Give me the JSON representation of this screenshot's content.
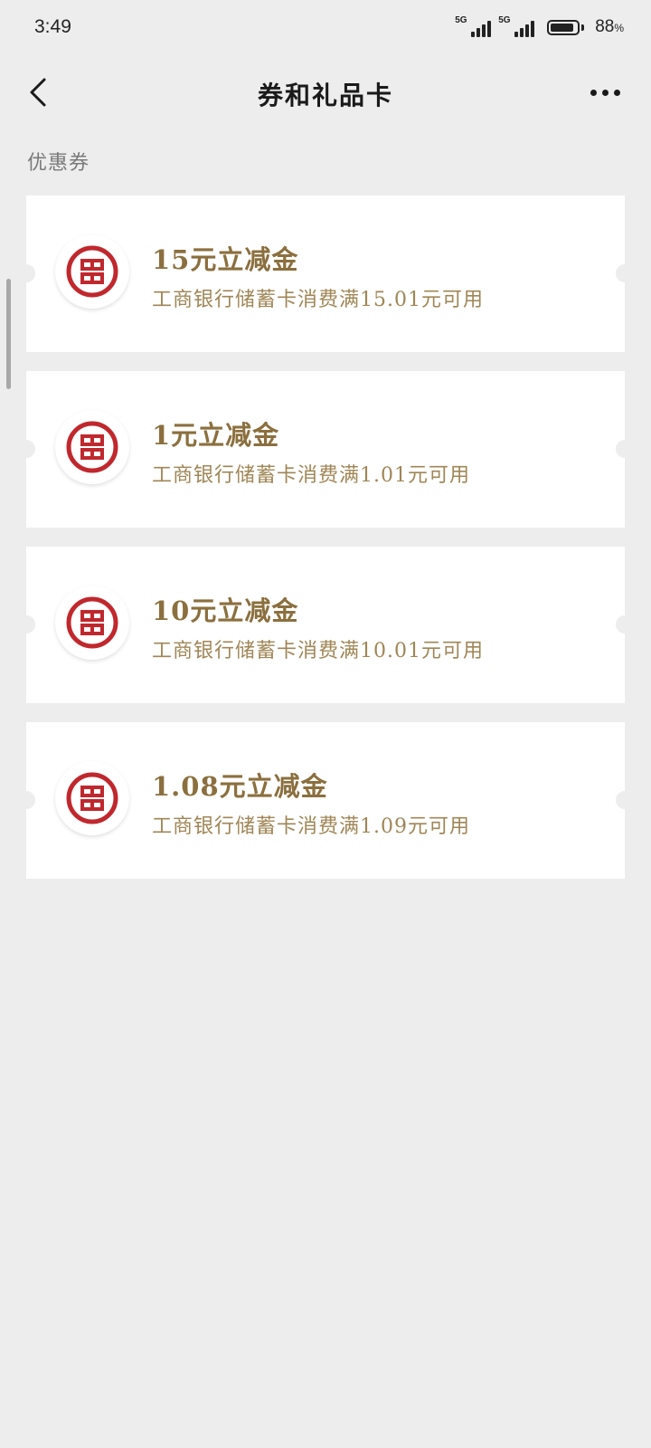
{
  "status_bar": {
    "time": "3:49",
    "network_1": "5G",
    "network_2": "5G",
    "battery_level": 88,
    "battery_text": "88"
  },
  "nav": {
    "title": "券和礼品卡",
    "back_icon": "chevron-left-icon",
    "more_icon": "more-dots-icon"
  },
  "section": {
    "label": "优惠券"
  },
  "colors": {
    "background": "#ededed",
    "card": "#ffffff",
    "title_gold": "#8b6f3e",
    "desc_gold": "#a08656",
    "logo_red": "#c0282d"
  },
  "coupons": [
    {
      "title": "15元立减金",
      "desc": "工商银行储蓄卡消费满15.01元可用",
      "icon": "icbc-logo-icon"
    },
    {
      "title": "1元立减金",
      "desc": "工商银行储蓄卡消费满1.01元可用",
      "icon": "icbc-logo-icon"
    },
    {
      "title": "10元立减金",
      "desc": "工商银行储蓄卡消费满10.01元可用",
      "icon": "icbc-logo-icon"
    },
    {
      "title": "1.08元立减金",
      "desc": "工商银行储蓄卡消费满1.09元可用",
      "icon": "icbc-logo-icon"
    }
  ]
}
